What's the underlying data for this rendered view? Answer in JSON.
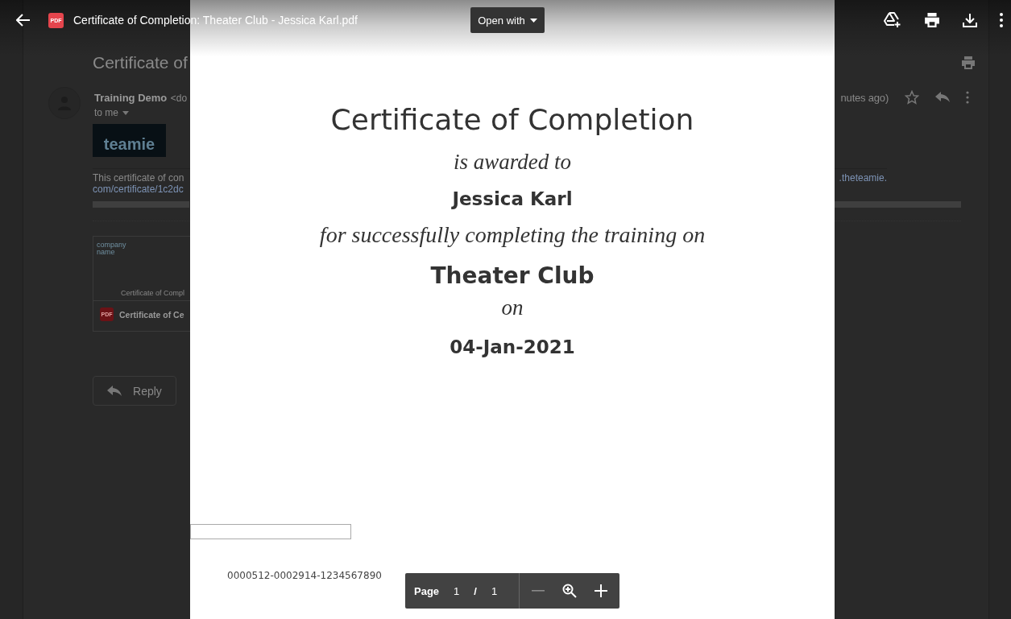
{
  "email": {
    "subject": "Certificate of",
    "sender": "Training Demo",
    "sender_address": "<do",
    "recipient": "to me",
    "logo": "teamie",
    "body": "This certificate of con",
    "link": "com/certificate/1c2dc",
    "link_end": ".theteamie.",
    "time": "nutes ago)",
    "attachment": {
      "thumb_logo": "company name",
      "thumb_title": "Certificate of Compl",
      "name": "Certificate of Ce",
      "file_badge": "PDF"
    },
    "reply": "Reply"
  },
  "viewer": {
    "file_badge": "PDF",
    "title": "Certificate of Completion: Theater Club - Jessica Karl.pdf",
    "open_with": "Open with",
    "page_controls": {
      "label": "Page",
      "current": "1",
      "separator": "/",
      "total": "1"
    }
  },
  "document": {
    "heading": "Certificate of Completion",
    "awarded": "is awarded to",
    "name": "Jessica Karl",
    "training": "for successfully completing the training on",
    "course": "Theater Club",
    "on": "on",
    "date": "04-Jan-2021",
    "serial": "0000512-0002914-1234567890"
  }
}
